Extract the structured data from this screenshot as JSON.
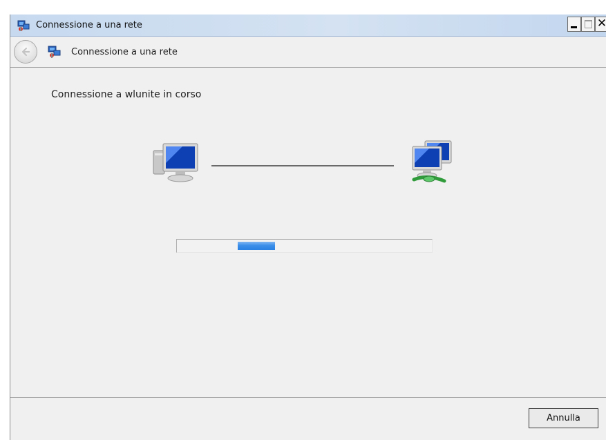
{
  "window": {
    "title": "Connessione a una rete",
    "controls": {
      "minimize": "minimize-icon",
      "maximize": "maximize-icon",
      "close": "close-icon"
    }
  },
  "nav": {
    "back_icon": "back-arrow-icon",
    "title": "Connessione a una rete"
  },
  "main": {
    "status_text": "Connessione a wlunite in corso",
    "progress": {
      "mode": "indeterminate",
      "position_fraction": 0.28
    },
    "icons": {
      "local": "computer-icon",
      "remote": "network-icon"
    }
  },
  "footer": {
    "cancel_label": "Annulla"
  },
  "colors": {
    "titlebar": "#c6d9ef",
    "progress_fill": "#3b8fe9",
    "background": "#f0f0f0"
  }
}
